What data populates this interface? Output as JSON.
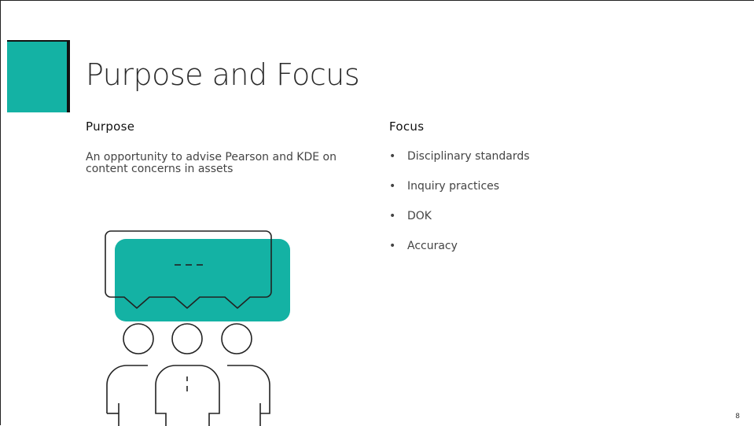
{
  "slide": {
    "title": "Purpose and Focus",
    "page_number": "8",
    "accent_color": "#14b2a4"
  },
  "purpose": {
    "heading": "Purpose",
    "text": "An opportunity to advise Pearson and KDE   on content concerns  in assets"
  },
  "focus": {
    "heading": "Focus",
    "items": [
      {
        "label": "Disciplinary standards"
      },
      {
        "label": "Inquiry practices"
      },
      {
        "label": "DOK"
      },
      {
        "label": "Accuracy"
      }
    ]
  },
  "illustration": {
    "icon": "group-discussion-icon"
  }
}
